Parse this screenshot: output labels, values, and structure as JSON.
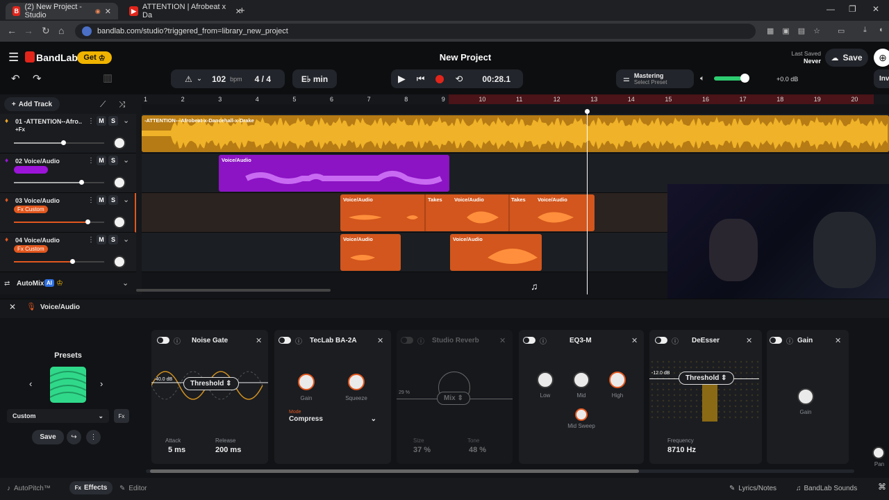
{
  "browser": {
    "tabs": [
      {
        "title": "(2) New Project - Studio",
        "active": true
      },
      {
        "title": "ATTENTION | Afrobeat x Da",
        "active": false
      }
    ],
    "url": "bandlab.com/studio?triggered_from=library_new_project"
  },
  "app": {
    "brand": "BandLab",
    "get_label": "Get",
    "project_title": "New Project",
    "last_saved_label": "Last Saved",
    "last_saved_value": "Never",
    "save_label": "Save"
  },
  "transport": {
    "bpm": "102",
    "bpm_unit": "bpm",
    "time_sig": "4 / 4",
    "key": "E♭ min",
    "time": "00:28.1",
    "mastering_title": "Mastering",
    "mastering_sub": "Select Preset",
    "master_volume": "+0.0 dB",
    "inv_label": "Inv"
  },
  "tracks_header": {
    "add_track": "Add Track"
  },
  "ruler": [
    "1",
    "2",
    "3",
    "4",
    "5",
    "6",
    "7",
    "8",
    "9",
    "10",
    "11",
    "12",
    "13",
    "14",
    "15",
    "16",
    "17",
    "18",
    "19",
    "20"
  ],
  "tracks": [
    {
      "name": "01 -ATTENTION--Afro...",
      "sub": "+Fx",
      "badge": "",
      "mute": "M",
      "solo": "S",
      "color": "#f0a826",
      "volume": 0.55
    },
    {
      "name": "02 Voice/Audio",
      "sub": "",
      "badge": "Fx Custom",
      "mute": "M",
      "solo": "S",
      "color": "#9b14d8",
      "volume": 0.75
    },
    {
      "name": "03 Voice/Audio",
      "sub": "",
      "badge": "Fx Custom",
      "mute": "M",
      "solo": "S",
      "color": "#e2571e",
      "volume": 0.82
    },
    {
      "name": "04 Voice/Audio",
      "sub": "",
      "badge": "Fx Custom",
      "mute": "M",
      "solo": "S",
      "color": "#e2571e",
      "volume": 0.65
    }
  ],
  "clips": {
    "track1": "-ATTENTION---Afrobeat-x-Dancehall-x-Drake",
    "track2": "Voice/Audio",
    "track3": [
      "Voice/Audio",
      "Takes",
      "Voice/Audio",
      "Takes",
      "Voice/Audio"
    ],
    "track4": [
      "Voice/Audio",
      "Voice/Audio"
    ]
  },
  "automix": {
    "label": "AutoMix",
    "ai": "AI"
  },
  "fx": {
    "header_title": "Voice/Audio",
    "presets_label": "Presets",
    "preset_name": "Custom",
    "save_label": "Save",
    "noise_gate": {
      "title": "Noise Gate",
      "threshold_label": "Threshold",
      "threshold_db": "40.0 dB",
      "attack_label": "Attack",
      "attack": "5 ms",
      "release_label": "Release",
      "release": "200 ms"
    },
    "teclab": {
      "title": "TecLab BA-2A",
      "gain": "Gain",
      "squeeze": "Squeeze",
      "mode_label": "Mode",
      "mode": "Compress"
    },
    "reverb": {
      "title": "Studio Reverb",
      "mix": "Mix",
      "mix_pct": "29 %",
      "size_label": "Size",
      "size": "37 %",
      "tone_label": "Tone",
      "tone": "48 %"
    },
    "eq": {
      "title": "EQ3-M",
      "low": "Low",
      "mid": "Mid",
      "high": "High",
      "sweep": "Mid Sweep"
    },
    "deesser": {
      "title": "DeEsser",
      "threshold_label": "Threshold",
      "threshold_db": "-12.0 dB",
      "freq_label": "Frequency",
      "freq": "8710 Hz"
    },
    "gain": {
      "title": "Gain",
      "knob": "Gain"
    },
    "pan": "Pan"
  },
  "bottom": {
    "autopitch": "AutoPitch™",
    "effects": "Effects",
    "editor": "Editor",
    "lyrics": "Lyrics/Notes",
    "sounds": "BandLab Sounds"
  }
}
